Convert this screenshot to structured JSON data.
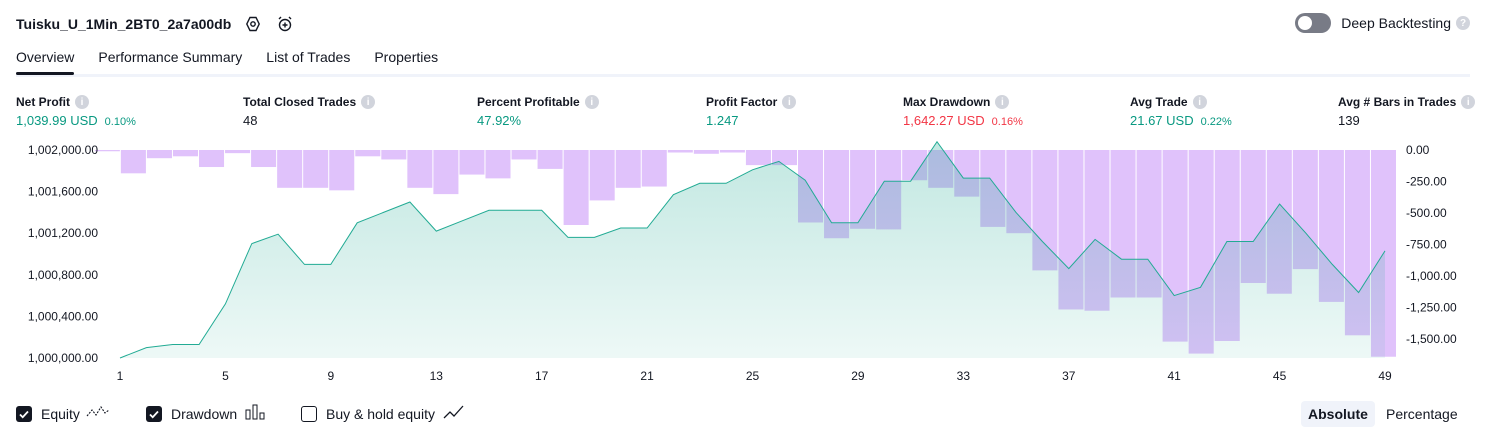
{
  "header": {
    "title": "Tuisku_U_1Min_2BT0_2a7a00db",
    "deep_label": "Deep Backtesting"
  },
  "tabs": [
    "Overview",
    "Performance Summary",
    "List of Trades",
    "Properties"
  ],
  "metrics": [
    {
      "label": "Net Profit",
      "value": "1,039.99 USD",
      "pct": "0.10%",
      "color": "green"
    },
    {
      "label": "Total Closed Trades",
      "value": "48",
      "pct": "",
      "color": "black"
    },
    {
      "label": "Percent Profitable",
      "value": "47.92%",
      "pct": "",
      "color": "green"
    },
    {
      "label": "Profit Factor",
      "value": "1.247",
      "pct": "",
      "color": "green"
    },
    {
      "label": "Max Drawdown",
      "value": "1,642.27 USD",
      "pct": "0.16%",
      "color": "red"
    },
    {
      "label": "Avg Trade",
      "value": "21.67 USD",
      "pct": "0.22%",
      "color": "green"
    },
    {
      "label": "Avg # Bars in Trades",
      "value": "139",
      "pct": "",
      "color": "black"
    }
  ],
  "legend": {
    "equity": "Equity",
    "drawdown": "Drawdown",
    "buyhold": "Buy & hold equity"
  },
  "modes": {
    "absolute": "Absolute",
    "percentage": "Percentage"
  },
  "colors": {
    "equity_line": "#22ab94",
    "equity_fill": "#c8ece3",
    "drawdown_bar": "#e0c2fb",
    "green": "#089981",
    "red": "#f23645"
  },
  "chart_data": {
    "type": "line+bar",
    "x_ticks": [
      1,
      5,
      9,
      13,
      17,
      21,
      25,
      29,
      33,
      37,
      41,
      45,
      49
    ],
    "x_range": [
      1,
      49
    ],
    "equity": {
      "name": "Equity",
      "ylim": [
        1000000,
        1002000
      ],
      "y_ticks": [
        "1,000,000.00",
        "1,000,400.00",
        "1,000,800.00",
        "1,001,200.00",
        "1,001,600.00",
        "1,002,000.00"
      ],
      "y_tick_values": [
        1000000,
        1000400,
        1000800,
        1001200,
        1001600,
        1002000
      ],
      "values": [
        1000000,
        1000100,
        1000130,
        1000130,
        1000520,
        1001100,
        1001190,
        1000900,
        1000900,
        1001300,
        1001400,
        1001500,
        1001220,
        1001320,
        1001420,
        1001420,
        1001420,
        1001160,
        1001160,
        1001250,
        1001250,
        1001570,
        1001680,
        1001680,
        1001810,
        1001890,
        1001710,
        1001300,
        1001300,
        1001700,
        1001700,
        1002080,
        1001730,
        1001730,
        1001400,
        1001120,
        1000860,
        1001140,
        1000950,
        1000950,
        1000600,
        1000680,
        1001120,
        1001120,
        1001480,
        1001200,
        1000900,
        1000630,
        1001030
      ]
    },
    "drawdown": {
      "name": "Drawdown",
      "ylim": [
        -1650,
        0
      ],
      "y_ticks": [
        "0.00",
        "-250.00",
        "-500.00",
        "-750.00",
        "-1,000.00",
        "-1,250.00",
        "-1,500.00"
      ],
      "y_tick_values": [
        0,
        -250,
        -500,
        -750,
        -1000,
        -1250,
        -1500
      ],
      "values": [
        -10,
        -185,
        -65,
        -50,
        -135,
        -25,
        -135,
        -300,
        -300,
        -320,
        -50,
        -75,
        -300,
        -350,
        -195,
        -225,
        -75,
        -150,
        -595,
        -400,
        -300,
        -290,
        -20,
        -30,
        -20,
        -120,
        -120,
        -575,
        -700,
        -625,
        -630,
        -240,
        -300,
        -370,
        -610,
        -660,
        -955,
        -1265,
        -1275,
        -1170,
        -1170,
        -1520,
        -1615,
        -1515,
        -1055,
        -1140,
        -945,
        -1205,
        -1470,
        -1640
      ]
    }
  }
}
